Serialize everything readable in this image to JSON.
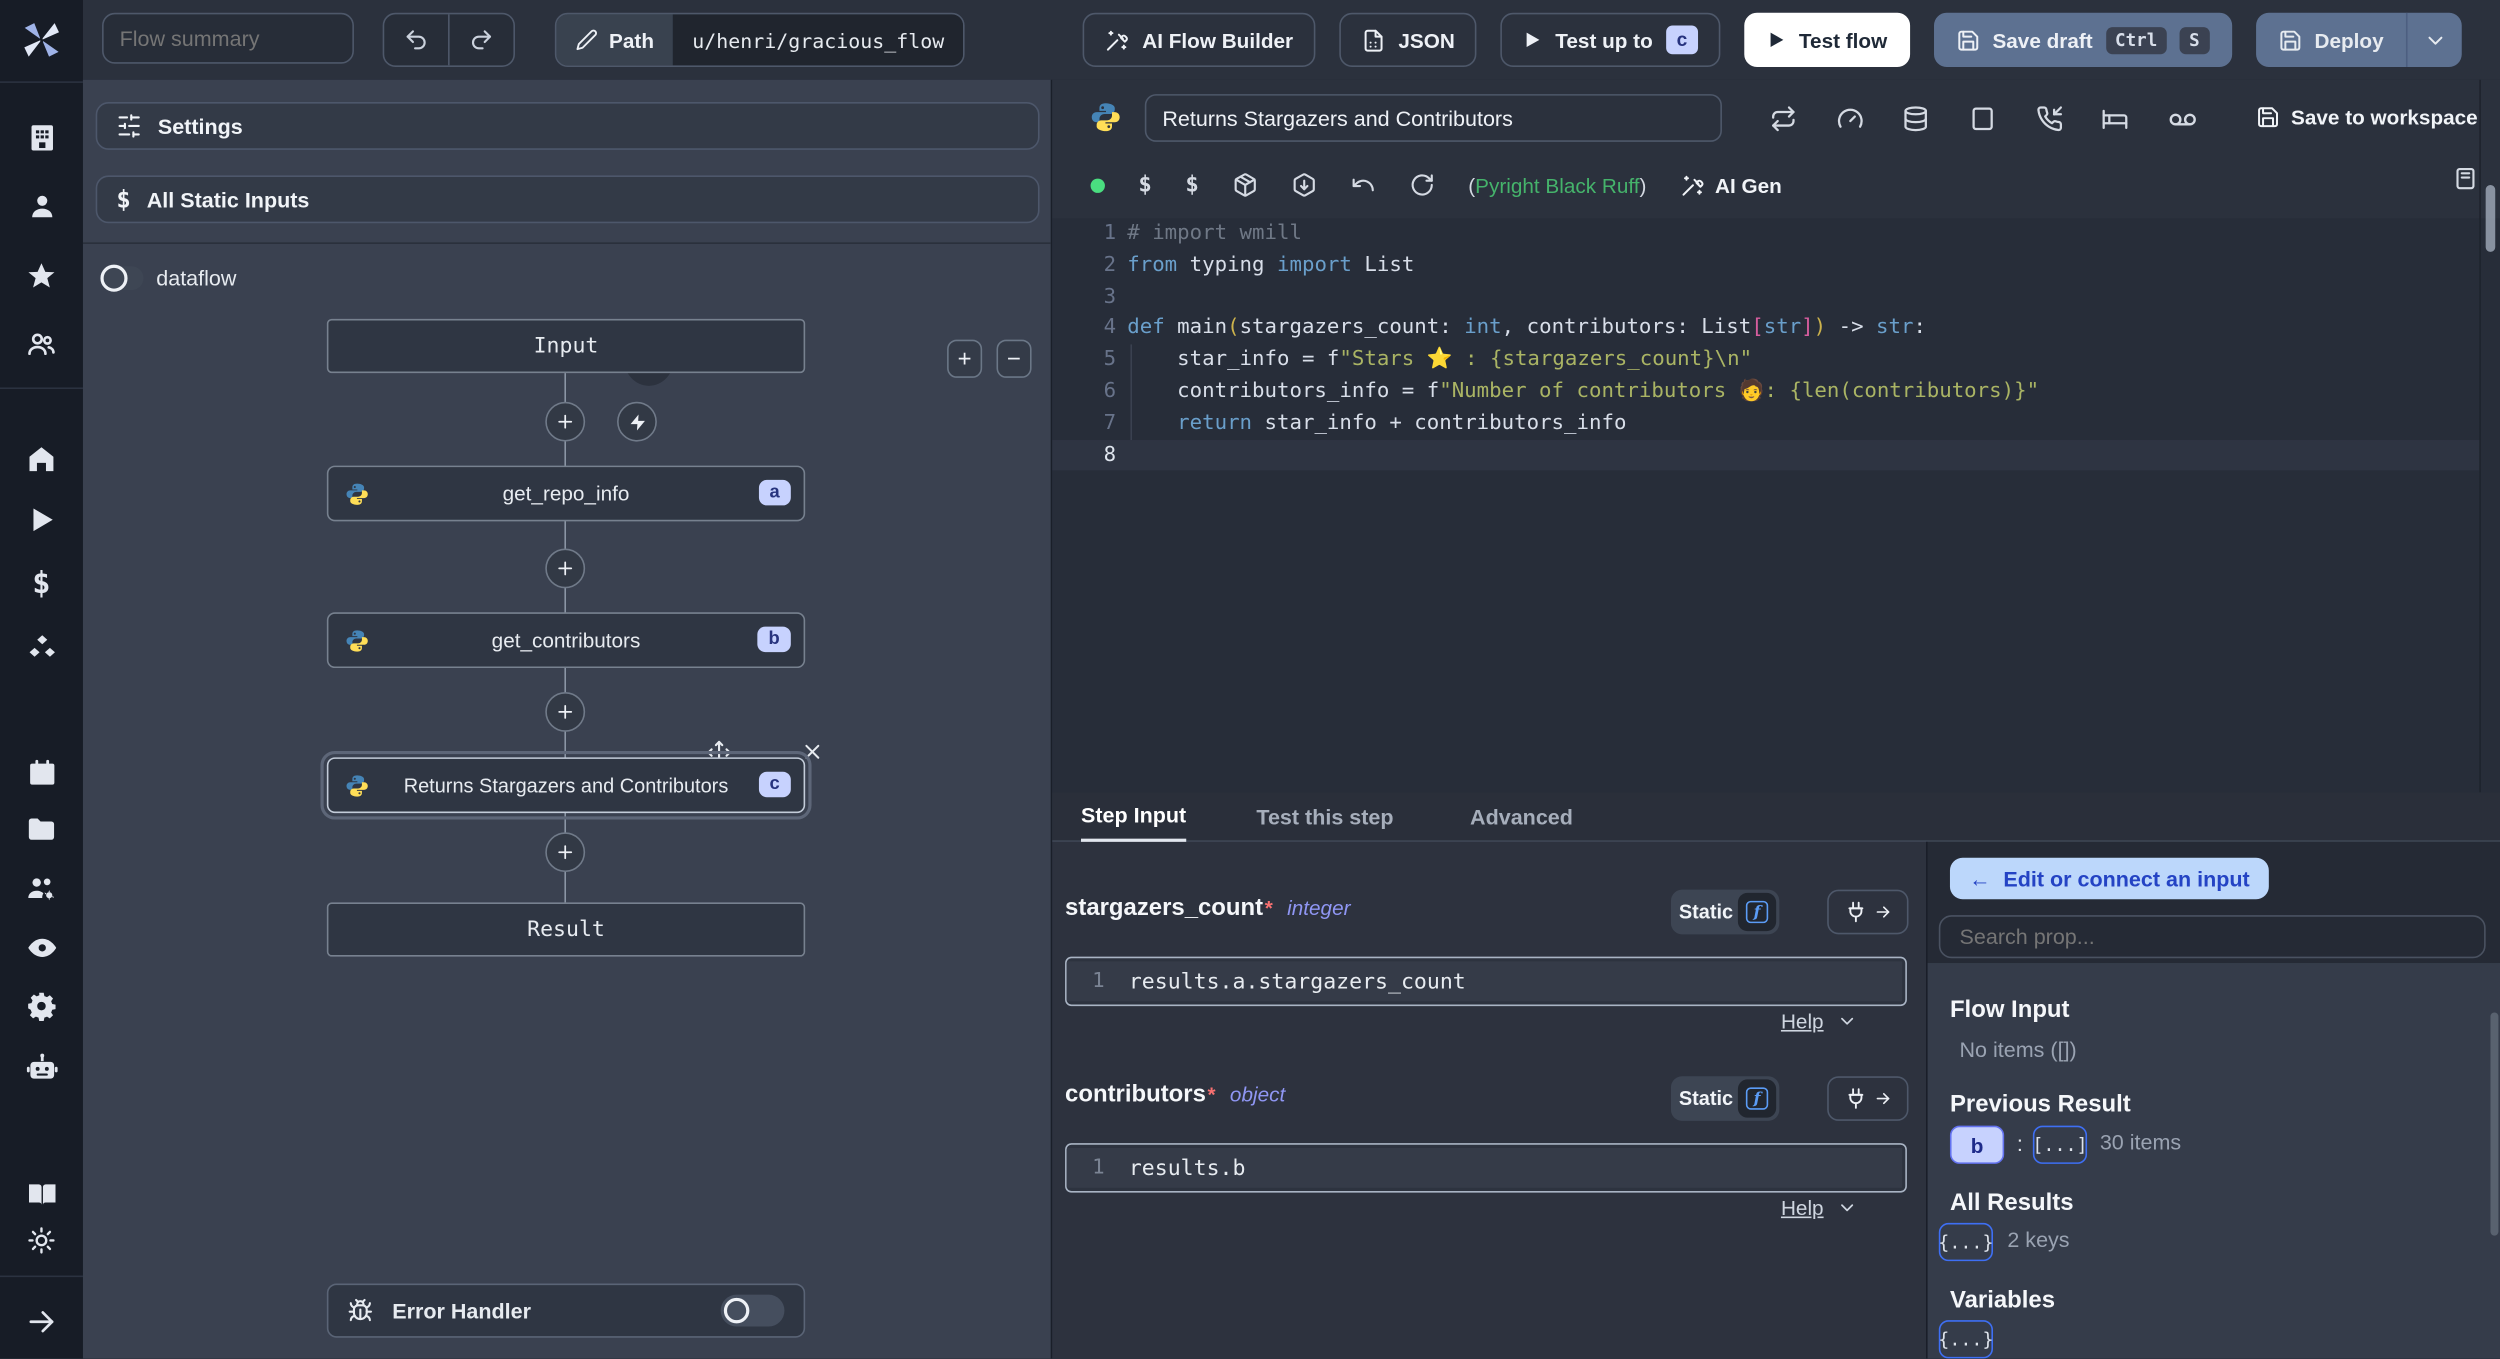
{
  "topbar": {
    "flow_summary_placeholder": "Flow summary",
    "path_label": "Path",
    "path_value": "u/henri/gracious_flow",
    "ai_flow_builder": "AI Flow Builder",
    "json_btn": "JSON",
    "test_up_to": "Test up to",
    "test_up_to_badge": "c",
    "test_flow": "Test flow",
    "save_draft": "Save draft",
    "kbd_ctrl": "Ctrl",
    "kbd_s": "S",
    "deploy": "Deploy"
  },
  "left": {
    "settings": "Settings",
    "all_static_inputs": "All Static Inputs",
    "dataflow": "dataflow",
    "zoom_in": "+",
    "zoom_out": "−",
    "graph": {
      "input_label": "Input",
      "result_label": "Result",
      "error_handler": "Error Handler",
      "nodes": [
        {
          "label": "get_repo_info",
          "badge": "a"
        },
        {
          "label": "get_contributors",
          "badge": "b"
        },
        {
          "label": "Returns Stargazers and Contributors",
          "badge": "c"
        }
      ]
    }
  },
  "editor": {
    "title": "Returns Stargazers and Contributors",
    "save_to_workspace": "Save to workspace",
    "dollar": "$",
    "lint_open": "(",
    "lint": "Pyright Black Ruff",
    "lint_close": ")",
    "ai_gen": "AI Gen",
    "code_lines": [
      [
        [
          "cmt",
          "# import wmill"
        ]
      ],
      [
        [
          "kw",
          "from"
        ],
        [
          "tx",
          " typing "
        ],
        [
          "kw",
          "import"
        ],
        [
          "tx",
          " List"
        ]
      ],
      [],
      [
        [
          "kw",
          "def"
        ],
        [
          "tx",
          " main"
        ],
        [
          "yl",
          "("
        ],
        [
          "tx",
          "stargazers_count: "
        ],
        [
          "kw",
          "int"
        ],
        [
          "tx",
          ", contributors: List"
        ],
        [
          "pk",
          "["
        ],
        [
          "kw",
          "str"
        ],
        [
          "pk",
          "]"
        ],
        [
          "yl",
          ")"
        ],
        [
          "tx",
          " -> "
        ],
        [
          "kw",
          "str"
        ],
        [
          "tx",
          ":"
        ]
      ],
      [
        [
          "tx",
          "    star_info = f"
        ],
        [
          "str",
          "\"Stars ⭐ : {stargazers_count}\\n\""
        ]
      ],
      [
        [
          "tx",
          "    contributors_info = f"
        ],
        [
          "str",
          "\"Number of contributors 🧑: {len(contributors)}\""
        ]
      ],
      [
        [
          "kw",
          "    return"
        ],
        [
          "tx",
          " star_info + contributors_info"
        ]
      ],
      []
    ]
  },
  "step": {
    "tabs": [
      {
        "label": "Step Input"
      },
      {
        "label": "Test this step"
      },
      {
        "label": "Advanced"
      }
    ],
    "fields": [
      {
        "name": "stargazers_count",
        "req": "*",
        "type": "integer",
        "mode": "Static",
        "ln": "1",
        "value": "results.a.stargazers_count",
        "help": "Help"
      },
      {
        "name": "contributors",
        "req": "*",
        "type": "object",
        "mode": "Static",
        "ln": "1",
        "value": "results.b",
        "help": "Help"
      }
    ]
  },
  "right": {
    "back_arrow": "←",
    "edit_connect": "Edit or connect an input",
    "search_placeholder": "Search prop...",
    "flow_input": "Flow Input",
    "no_items": "No items ([])",
    "previous_result": "Previous Result",
    "prev_badge": "b",
    "colon": ":",
    "array_badge": "[...]",
    "items_count": "30 items",
    "all_results": "All Results",
    "obj_badge": "{...}",
    "keys_count": "2 keys",
    "variables": "Variables",
    "var_badge": "{...}"
  }
}
